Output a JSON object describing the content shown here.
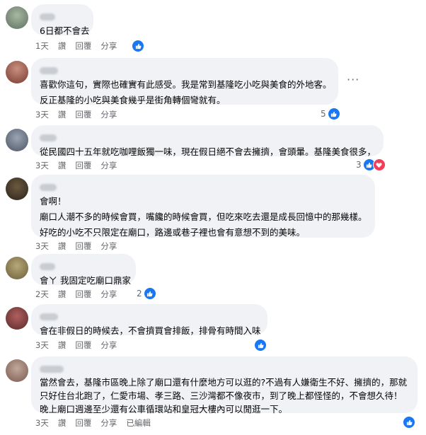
{
  "actions": {
    "reply": "讚",
    "hide": "回覆",
    "share": "分享",
    "edited": "已編輯"
  },
  "comments": [
    {
      "lines": [
        "6日都不會去"
      ],
      "time": "1天",
      "reaction_count": ""
    },
    {
      "lines": [
        "喜歡你這句，實際也確實有此感受。我是常到基隆吃小吃與美食的外地客。",
        "反正基隆的小吃與美食幾乎是街角轉個彎就有。"
      ],
      "time": "3天",
      "reaction_count": "5"
    },
    {
      "lines": [
        "從民國四十五年就吃咖哩飯獨一味，現在假日絕不會去擁擠，會頭暈。基隆美食很多，"
      ],
      "time": "3天",
      "reaction_count": "3"
    },
    {
      "lines": [
        "會啊！",
        "廟口人潮不多的時候會買，嘴饞的時候會買，但吃來吃去還是成長回憶中的那幾樣。",
        "好吃的小吃不只限定在廟口，路邊或巷子裡也會有意想不到的美味。"
      ],
      "time": "3天",
      "reaction_count": ""
    },
    {
      "lines": [
        "會ㄚ 我固定吃廟口鼎家"
      ],
      "time": "2天",
      "reaction_count": "2"
    },
    {
      "lines": [
        "會在非假日的時候去，不會擠買會排飯，排骨有時間入味"
      ],
      "time": "3天",
      "reaction_count": ""
    },
    {
      "lines": [
        "當然會去，基隆市區晚上除了廟口還有什麼地方可以逛的?不過有人嫌衛生不好、擁擠的，那就",
        "只好住台北跑了，仁愛市場、孝三路、三沙灣都不像夜市，到了晚上都怪怪的，不會想久待！",
        "晚上廟口週邊至少還有公車循環站和皇冠大樓內可以閒逛一下。"
      ],
      "time": "3天",
      "reaction_count": ""
    }
  ]
}
